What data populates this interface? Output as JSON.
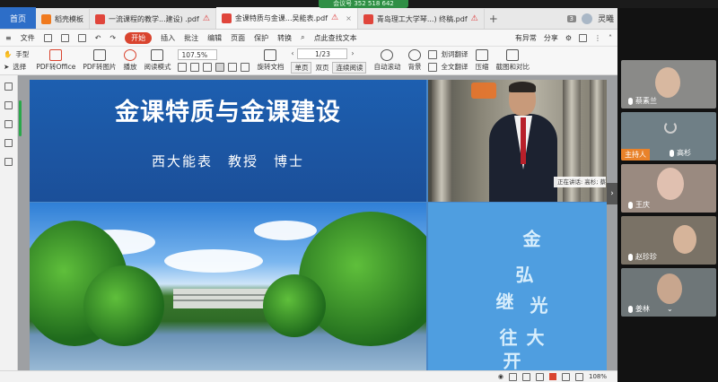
{
  "meeting": {
    "banner": "会议号 352 518 642"
  },
  "tabs": {
    "home": "首页",
    "items": [
      {
        "label": "稻壳模板",
        "icon": "docer-icon",
        "color": "#f07a1e"
      },
      {
        "label": "一流课程的教学...建设) .pdf",
        "icon": "pdf-icon",
        "color": "#e0453b",
        "warn": ""
      },
      {
        "label": "金课特质与金课...吴能表.pdf",
        "icon": "pdf-icon",
        "color": "#e0453b",
        "warn": "⚠",
        "close": "×"
      },
      {
        "label": "青岛理工大学琴...) 终稿.pdf",
        "icon": "pdf-icon",
        "color": "#e0453b",
        "warn": "⚠"
      }
    ],
    "add": "+",
    "count": "3",
    "user": "灵曦"
  },
  "menubar": {
    "file": "文件",
    "items": [
      "开始",
      "插入",
      "批注",
      "编辑",
      "页面",
      "保护",
      "转换"
    ],
    "search": "点此查找文本",
    "abnormal": "有异常",
    "share": "分享"
  },
  "toolbar": {
    "hand": "手型",
    "select": "选择",
    "pdf_office": "PDF转Office",
    "pdf_image": "PDF转图片",
    "play": "播放",
    "read_mode": "阅读模式",
    "zoom": "107.5%",
    "page": "1/23",
    "rotate": "旋转文档",
    "single": "单页",
    "double": "双页",
    "continuous": "连续阅读",
    "auto_scroll": "自动滚动",
    "background": "背景",
    "word_translate": "划词翻译",
    "full_translate": "全文翻译",
    "compress": "压缩",
    "screenshot": "截图和对比"
  },
  "slide": {
    "title": "金课特质与金课建设",
    "author": "西大能表　教授　博士",
    "speaking": "正在讲话: 高杉; 蔡素",
    "calligraphy": [
      "金",
      "弘",
      "光",
      "大",
      "继",
      "往",
      "开"
    ]
  },
  "statusbar": {
    "zoom": "108%"
  },
  "participants": [
    {
      "name": "蔡素兰",
      "bg": "#8a8a88",
      "face": "#d8b8a0"
    },
    {
      "name": "高杉",
      "bg": "#6f7f86",
      "face": "#c9a890",
      "host": "主持人"
    },
    {
      "name": "王庆",
      "bg": "#9a8a80",
      "face": "#e0c0b0"
    },
    {
      "name": "赵珍珍",
      "bg": "#7a7266",
      "face": "#d6b49a"
    },
    {
      "name": "姜林",
      "bg": "#6e7678",
      "face": "#c8a68e"
    }
  ]
}
